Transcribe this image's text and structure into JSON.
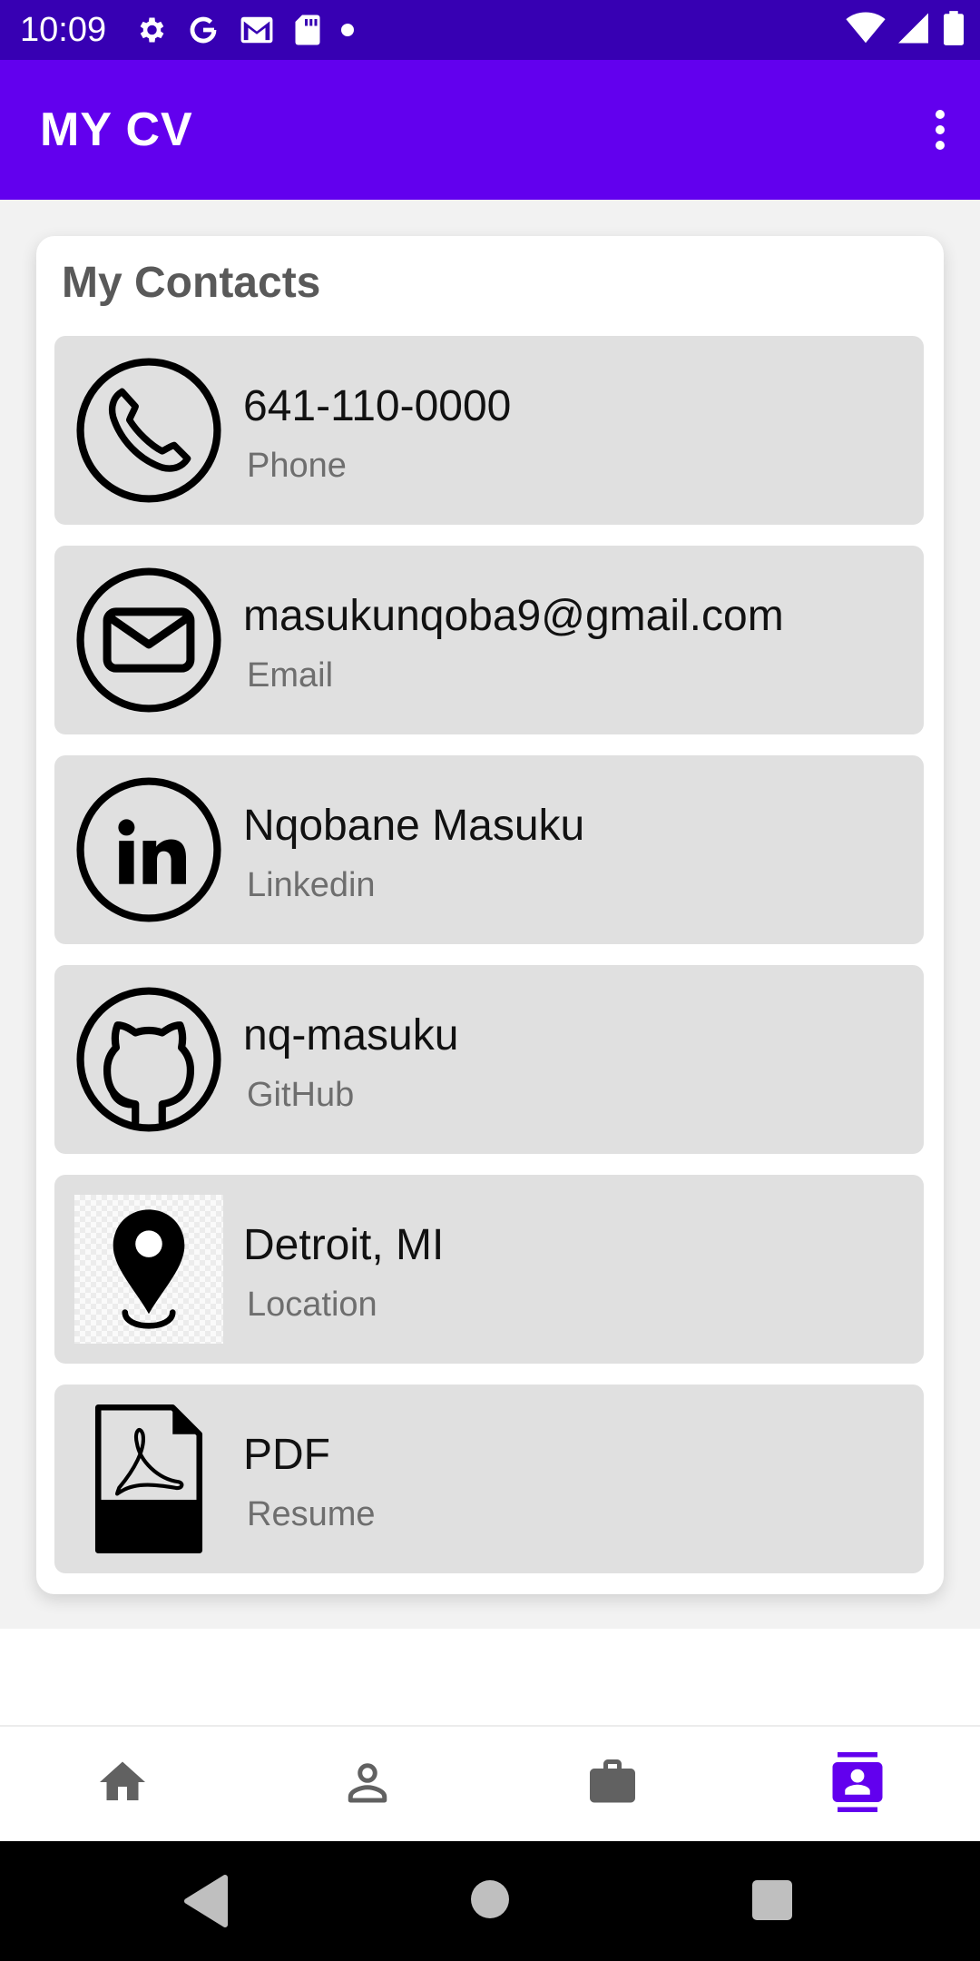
{
  "status_bar": {
    "time": "10:09",
    "left_icons": [
      "settings-icon",
      "google-icon",
      "gmail-icon",
      "sd-card-icon",
      "notification-dot-icon"
    ],
    "right_icons": [
      "wifi-icon",
      "cellular-icon",
      "battery-icon"
    ]
  },
  "app_bar": {
    "title": "MY CV",
    "menu_icon": "more-vert-icon"
  },
  "card": {
    "title": "My Contacts",
    "items": [
      {
        "value": "641-110-0000",
        "label": "Phone",
        "icon": "phone-icon"
      },
      {
        "value": "masukunqoba9@gmail.com",
        "label": "Email",
        "icon": "email-icon"
      },
      {
        "value": "Nqobane Masuku",
        "label": "Linkedin",
        "icon": "linkedin-icon"
      },
      {
        "value": "nq-masuku",
        "label": "GitHub",
        "icon": "github-icon"
      },
      {
        "value": "Detroit, MI",
        "label": "Location",
        "icon": "location-pin-icon"
      },
      {
        "value": "PDF",
        "label": "Resume",
        "icon": "pdf-file-icon"
      }
    ]
  },
  "bottom_nav": {
    "items": [
      {
        "icon": "home-icon",
        "selected": false
      },
      {
        "icon": "person-icon",
        "selected": false
      },
      {
        "icon": "briefcase-icon",
        "selected": false
      },
      {
        "icon": "contacts-icon",
        "selected": true
      }
    ]
  },
  "colors": {
    "status_bar": "#3700b3",
    "app_bar": "#6200ee",
    "accent": "#6200ee",
    "nav_inactive": "#616161",
    "item_background": "#e0e0e0"
  },
  "system_nav": [
    "back-icon",
    "home-circle-icon",
    "recents-icon"
  ]
}
